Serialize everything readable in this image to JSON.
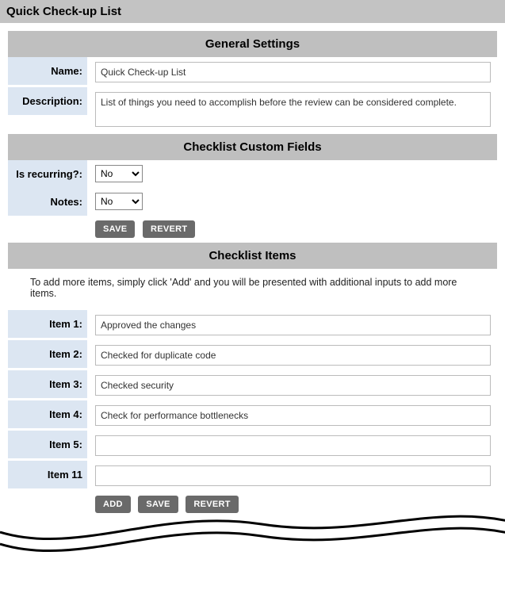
{
  "page_title": "Quick Check-up List",
  "sections": {
    "general": {
      "header": "General Settings",
      "name_label": "Name:",
      "name_value": "Quick Check-up List",
      "description_label": "Description:",
      "description_value": "List of things you need to accomplish before the review can be considered complete."
    },
    "custom_fields": {
      "header": "Checklist Custom Fields",
      "recurring_label": "Is recurring?:",
      "recurring_value": "No",
      "notes_label": "Notes:",
      "notes_value": "No",
      "save_label": "SAVE",
      "revert_label": "REVERT"
    },
    "items": {
      "header": "Checklist Items",
      "instructions": "To add more items, simply click 'Add' and you will be presented with additional inputs to add more items.",
      "rows": [
        {
          "label": "Item 1:",
          "value": "Approved the changes"
        },
        {
          "label": "Item 2:",
          "value": "Checked for duplicate code"
        },
        {
          "label": "Item 3:",
          "value": "Checked security"
        },
        {
          "label": "Item 4:",
          "value": "Check for performance bottlenecks"
        },
        {
          "label": "Item 5:",
          "value": ""
        },
        {
          "label": "Item 11",
          "value": ""
        }
      ],
      "add_label": "ADD",
      "save_label": "SAVE",
      "revert_label": "REVERT"
    }
  }
}
